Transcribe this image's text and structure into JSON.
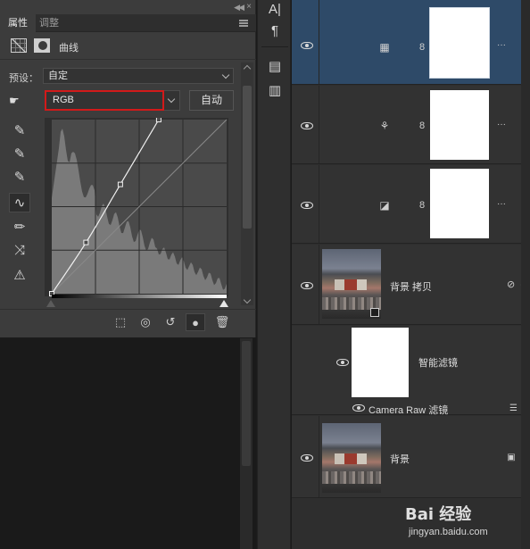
{
  "properties_panel": {
    "tabs": [
      "属性",
      "调整"
    ],
    "header_title": "曲线",
    "preset_label": "预设：",
    "preset_value": "自定",
    "channel_value": "RGB",
    "auto_label": "自动"
  },
  "curve": {
    "points": [
      [
        0,
        0
      ],
      [
        50,
        75
      ],
      [
        100,
        160
      ],
      [
        156,
        255
      ]
    ],
    "range": [
      0,
      255
    ]
  },
  "middle_strip": {
    "icons": [
      "character-icon",
      "paragraph-icon",
      "properties-icon",
      "notes-icon"
    ]
  },
  "layers": {
    "rows": [
      {
        "name": "",
        "type": "curves-adjustment",
        "selected": true
      },
      {
        "name": "",
        "type": "hue-saturation-adjustment",
        "selected": false
      },
      {
        "name": "",
        "type": "exposure-adjustment",
        "selected": false
      },
      {
        "name": "背景 拷贝",
        "type": "smart-object",
        "selected": false
      },
      {
        "name": "智能滤镜",
        "type": "smart-filters",
        "selected": false
      },
      {
        "name": "Camera Raw 滤镜",
        "type": "filter",
        "selected": false
      },
      {
        "name": "背景",
        "type": "background",
        "selected": false
      }
    ]
  },
  "watermark": {
    "brand": "Bai 经验",
    "site": "jingyan.baidu.com"
  },
  "colors": {
    "selected_layer": "#2e4a68",
    "channel_highlight": "#d21a1a",
    "panel_bg": "#3c3c3c"
  }
}
